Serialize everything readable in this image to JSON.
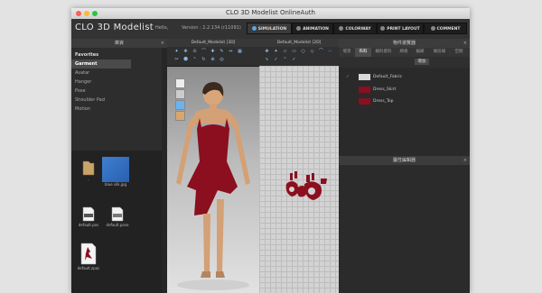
{
  "window": {
    "title": "CLO 3D Modelist OnlineAuth",
    "traffic_colors": [
      "#fc5f57",
      "#fdbc2e",
      "#28c840"
    ]
  },
  "menubar": {
    "logo": "CLO 3D Modelist",
    "hello": "Hello,",
    "version": "Version : 2.2.134 (r11091)",
    "modes": [
      {
        "label": "SIMULATION",
        "active": true
      },
      {
        "label": "ANIMATION",
        "active": false
      },
      {
        "label": "COLORWAY",
        "active": false
      },
      {
        "label": "PRINT LAYOUT",
        "active": false
      },
      {
        "label": "COMMENT",
        "active": false
      }
    ]
  },
  "library": {
    "title": "庫資",
    "tree": [
      {
        "label": "Favorites",
        "bold": true
      },
      {
        "label": "Garment",
        "bold": true,
        "selected": true
      },
      {
        "label": "Avatar"
      },
      {
        "label": "Hanger"
      },
      {
        "label": "Pose"
      },
      {
        "label": "Shoulder Pad"
      },
      {
        "label": "Motion"
      }
    ],
    "files": [
      {
        "name": "..",
        "icon": "folder-icon"
      },
      {
        "name": "blue silk.jpg",
        "icon": "blue-image-thumbnail"
      },
      {
        "name": "default.pos",
        "icon": "pos-file-icon"
      },
      {
        "name": "default.pose",
        "icon": "pose-file-icon"
      },
      {
        "name": "default.zpac",
        "icon": "zpac-file-icon"
      }
    ]
  },
  "viewport3d": {
    "title": "Default_Modelist [3D]"
  },
  "viewport2d": {
    "title": "Default_Modelist [2D]"
  },
  "object_browser": {
    "title": "物件瀏覽器",
    "tabs": [
      "場景",
      "布料",
      "輔料資料",
      "網格",
      "編織",
      "線段線",
      "空間"
    ],
    "active_tab": 1,
    "add_label": "增加",
    "fabrics": [
      {
        "name": "Default_Fabric",
        "color": "#d8d8d8",
        "checked": true
      },
      {
        "name": "Dress_Skirt",
        "color": "#8b0f1e",
        "checked": false
      },
      {
        "name": "Dress_Top",
        "color": "#8b0f1e",
        "checked": false
      }
    ]
  },
  "property_editor": {
    "title": "屬性編輯器"
  }
}
